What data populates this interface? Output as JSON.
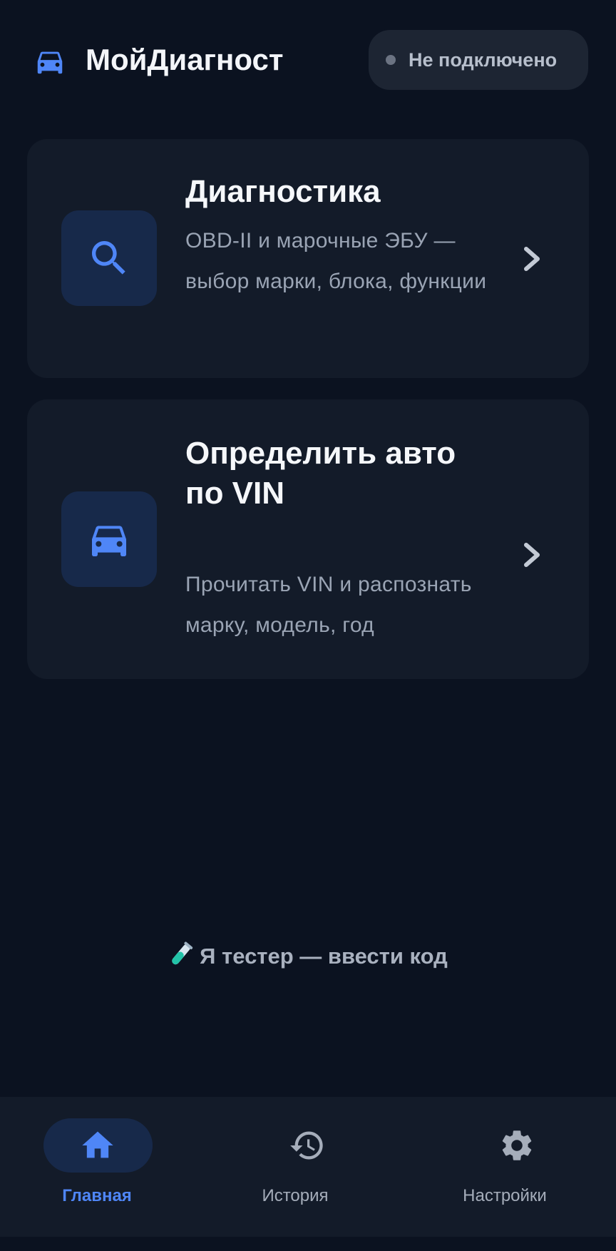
{
  "colors": {
    "background": "#0b1220",
    "card": "#131b29",
    "accent": "#4f86f7",
    "icon_box": "#17294a",
    "status_dot": "#6b7382"
  },
  "header": {
    "logo_icon": "car-icon",
    "title": "МойДиагност",
    "status": {
      "indicator": "status-dot",
      "text": "Не подключено"
    }
  },
  "cards": [
    {
      "icon": "search-icon",
      "title": "Диагностика",
      "description": "OBD-II и марочные ЭБУ — выбор марки, блока, функции",
      "chevron": "chevron-right-icon"
    },
    {
      "icon": "car-icon",
      "title": "Определить авто по VIN",
      "description": "Прочитать VIN и распознать марку, модель, год",
      "chevron": "chevron-right-icon"
    }
  ],
  "tester_link": {
    "icon": "test-tube-emoji",
    "label": "Я тестер — ввести код"
  },
  "bottom_nav": {
    "items": [
      {
        "icon": "home-icon",
        "label": "Главная",
        "active": true
      },
      {
        "icon": "history-icon",
        "label": "История",
        "active": false
      },
      {
        "icon": "gear-icon",
        "label": "Настройки",
        "active": false
      }
    ]
  }
}
